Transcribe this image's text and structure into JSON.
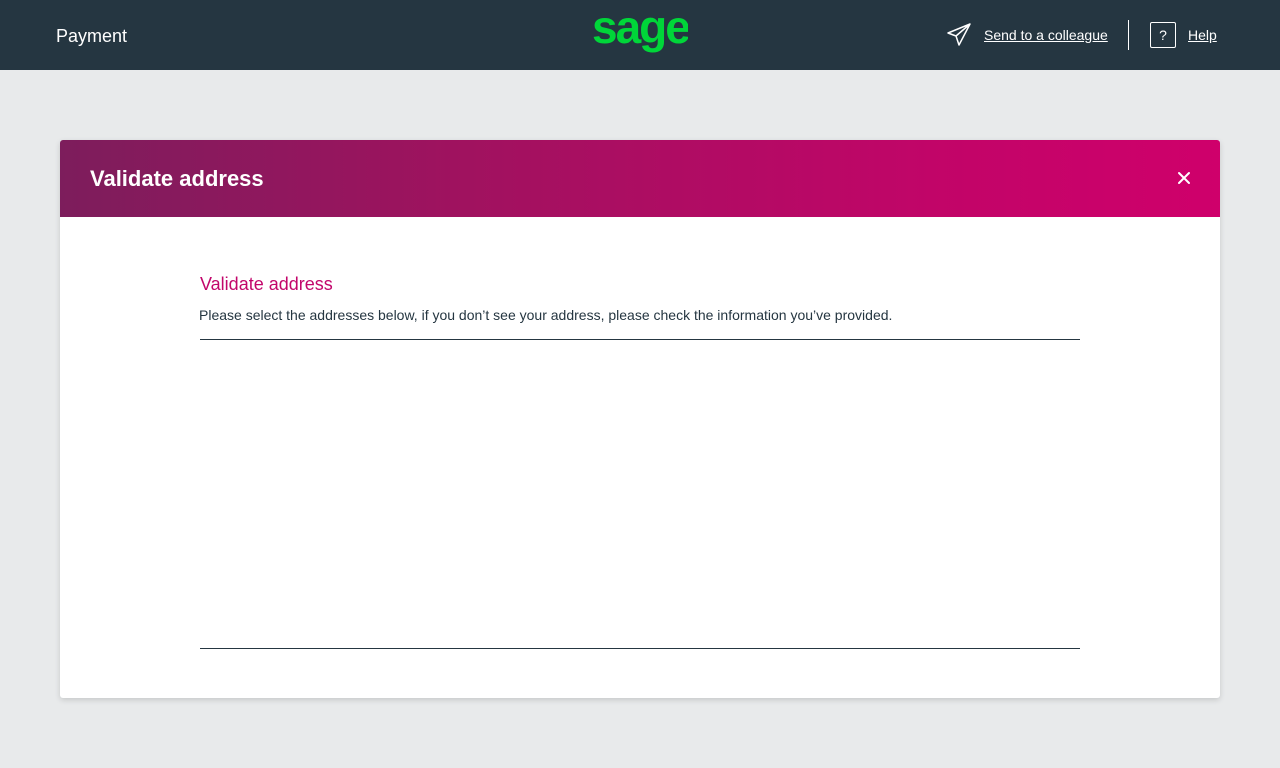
{
  "header": {
    "page_title": "Payment",
    "logo_text": "sage",
    "send_label": "Send to a colleague",
    "help_icon_glyph": "?",
    "help_label": "Help"
  },
  "dialog": {
    "title": "Validate address",
    "close_glyph": "×",
    "section_title": "Validate address",
    "description": "Please select the addresses below, if you don’t see your address, please check the information you’ve provided.",
    "addresses": []
  },
  "colors": {
    "topbar": "#253641",
    "brand_green": "#00d639",
    "accent_magenta": "#c2066b",
    "page_background": "#e8eaeb"
  },
  "icons": {
    "send": "paper-plane-icon",
    "help": "question-icon",
    "close": "close-icon"
  }
}
